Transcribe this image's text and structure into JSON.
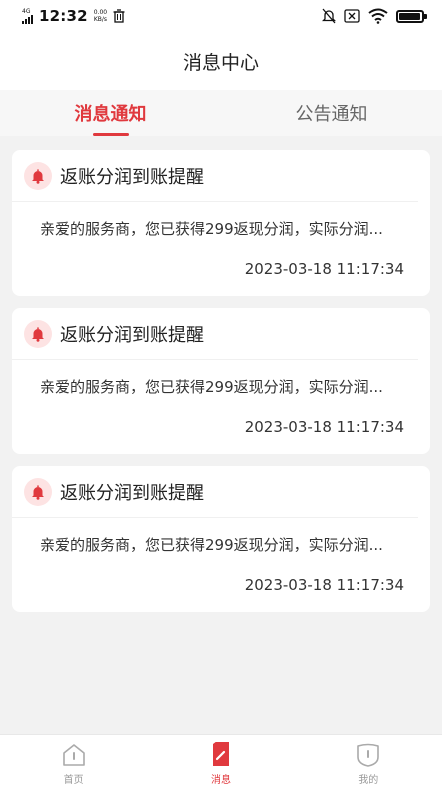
{
  "status_bar": {
    "network": "4G",
    "time": "12:32",
    "speed_value": "0.00",
    "speed_unit": "KB/s"
  },
  "header": {
    "title": "消息中心"
  },
  "tabs": [
    {
      "label": "消息通知",
      "active": true
    },
    {
      "label": "公告通知",
      "active": false
    }
  ],
  "messages": [
    {
      "title": "返账分润到账提醒",
      "body": "亲爱的服务商，您已获得299返现分润，实际分润...",
      "time": "2023-03-18 11:17:34"
    },
    {
      "title": "返账分润到账提醒",
      "body": "亲爱的服务商，您已获得299返现分润，实际分润...",
      "time": "2023-03-18 11:17:34"
    },
    {
      "title": "返账分润到账提醒",
      "body": "亲爱的服务商，您已获得299返现分润，实际分润...",
      "time": "2023-03-18 11:17:34"
    }
  ],
  "bottom_nav": [
    {
      "label": "首页",
      "icon": "home-icon",
      "active": false
    },
    {
      "label": "消息",
      "icon": "message-icon",
      "active": true
    },
    {
      "label": "我的",
      "icon": "profile-icon",
      "active": false
    }
  ],
  "colors": {
    "accent": "#e0393e",
    "bell_bg": "#fde3e3",
    "page_bg": "#f2f2f2"
  },
  "battery_level": 0.95
}
